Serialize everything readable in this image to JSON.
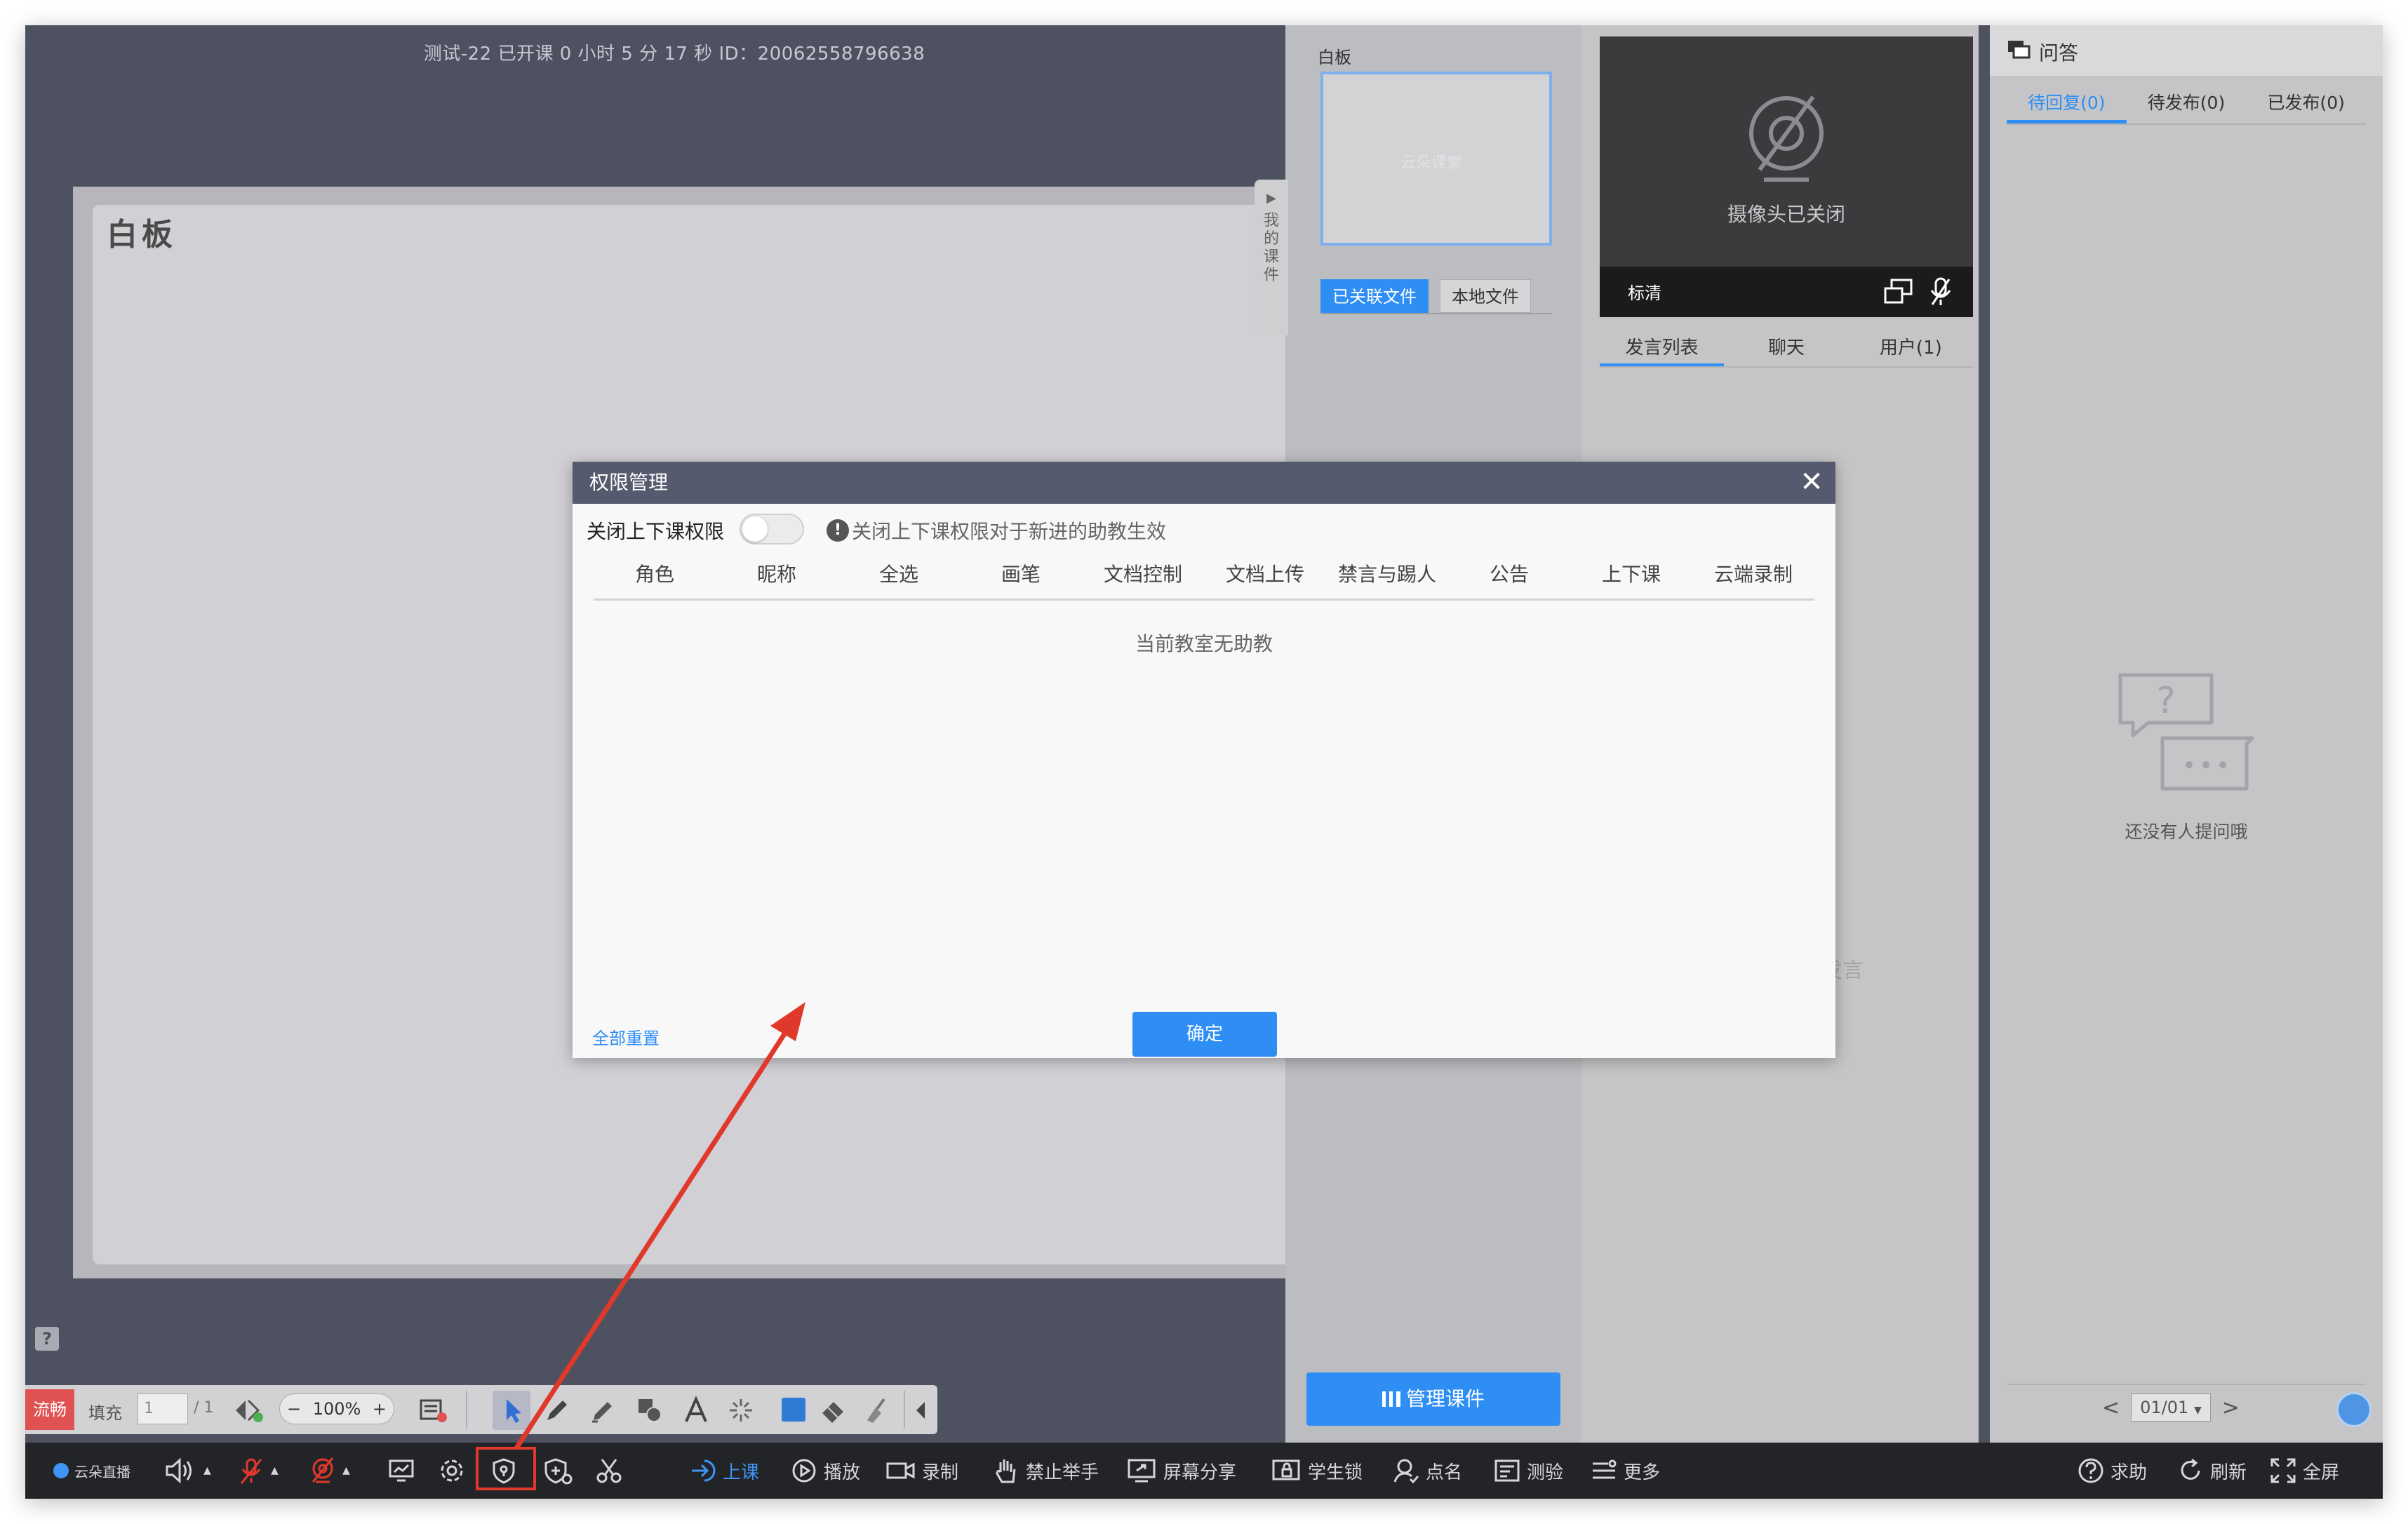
{
  "stage": {
    "top_info": "测试-22    已开课 0 小时 5 分 17 秒    ID：20062558796638",
    "whiteboard_title": "白板",
    "help_glyph": "?"
  },
  "courseware": {
    "handle_label": "我的课件",
    "thumb_label": "白板",
    "thumb_watermark": "云朵课堂",
    "tabs": [
      {
        "label": "已关联文件",
        "active": true
      },
      {
        "label": "本地文件",
        "active": false
      }
    ],
    "manage_button": "管理课件"
  },
  "video": {
    "camera_off_text": "摄像头已关闭",
    "quality": "标清"
  },
  "chat": {
    "tabs": [
      "发言列表",
      "聊天",
      "用户(1)"
    ],
    "ghost_text": "发言"
  },
  "qa": {
    "title": "问答",
    "tabs": [
      "待回复(0)",
      "待发布(0)",
      "已发布(0)"
    ],
    "empty_text": "还没有人提问哦",
    "pager": {
      "prev": "<",
      "page": "01/01",
      "next": ">"
    }
  },
  "wb_toolbar": {
    "fluency": "流畅",
    "fill": "填充",
    "page_value": "1",
    "page_total": "/ 1",
    "zoom_minus": "−",
    "zoom_value": "100%",
    "zoom_plus": "+"
  },
  "bottom_bar": {
    "logo": "云朵直播",
    "items": {
      "class": "上课",
      "play": "播放",
      "record": "录制",
      "no_hands": "禁止举手",
      "screen_share": "屏幕分享",
      "student_lock": "学生锁",
      "roll_call": "点名",
      "quiz": "测验",
      "more": "更多",
      "help": "求助",
      "refresh": "刷新",
      "fullscreen": "全屏"
    }
  },
  "dialog": {
    "title": "权限管理",
    "close": "✕",
    "switch_label": "关闭上下课权限",
    "switch_on": false,
    "hint_icon": "!",
    "hint": "关闭上下课权限对于新进的助教生效",
    "columns": [
      "角色",
      "昵称",
      "全选",
      "画笔",
      "文档控制",
      "文档上传",
      "禁言与踢人",
      "公告",
      "上下课",
      "云端录制"
    ],
    "empty_text": "当前教室无助教",
    "reset_label": "全部重置",
    "ok_label": "确定"
  },
  "colors": {
    "accent": "#2f8ef4",
    "stage_bg": "#4d5160",
    "annotation_red": "#e0392b",
    "toolbar_bg": "#232428"
  }
}
